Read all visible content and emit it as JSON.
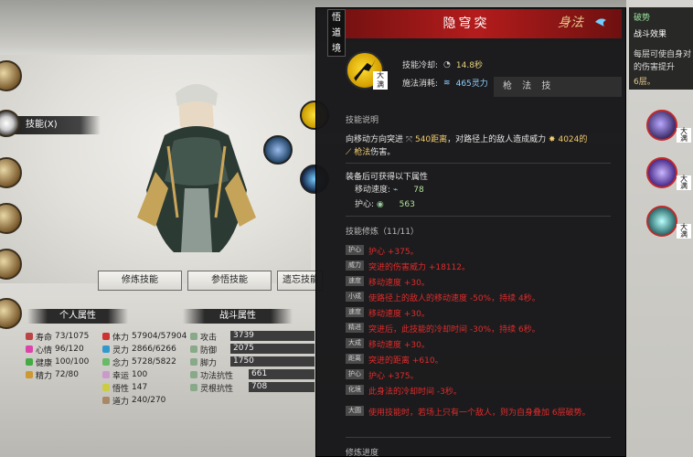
{
  "left_tab": {
    "label": "技能(X)"
  },
  "actions": {
    "cultivate": "修炼技能",
    "comprehend": "参悟技能",
    "forget": "遗忘技能"
  },
  "personal": {
    "header": "个人属性",
    "stats": [
      {
        "label": "寿命",
        "value": "73/1075",
        "color": "#b44"
      },
      {
        "label": "心情",
        "value": "96/120",
        "color": "#d4a"
      },
      {
        "label": "健康",
        "value": "100/100",
        "color": "#4a4"
      },
      {
        "label": "精力",
        "value": "72/80",
        "color": "#c93"
      }
    ],
    "stats2": [
      {
        "label": "体力",
        "value": "57904/57904",
        "color": "#c33"
      },
      {
        "label": "灵力",
        "value": "2866/6266",
        "color": "#39c"
      },
      {
        "label": "念力",
        "value": "5728/5822",
        "color": "#6b6"
      },
      {
        "label": "幸运",
        "value": "100",
        "color": "#c9c"
      },
      {
        "label": "悟性",
        "value": "147",
        "color": "#cc4"
      },
      {
        "label": "道力",
        "value": "240/270",
        "color": "#a86"
      }
    ]
  },
  "combat": {
    "header": "战斗属性",
    "stats": [
      {
        "label": "攻击",
        "value": "3739"
      },
      {
        "label": "防御",
        "value": "2075"
      },
      {
        "label": "脚力",
        "value": "1750"
      },
      {
        "label": "功法抗性",
        "value": "661"
      },
      {
        "label": "灵根抗性",
        "value": "708"
      }
    ]
  },
  "popup": {
    "vertical_tag": "悟\n道\n境",
    "title": "隐穹突",
    "category": "身法",
    "icon_badge": "大\n满",
    "cooldown_label": "技能冷却:",
    "cooldown_value": "14.8秒",
    "cost_label": "施法消耗:",
    "cost_value": "465灵力",
    "desc_title": "技能说明",
    "desc_a": "向移动方向突进",
    "desc_dist": "540距离",
    "desc_b": "，对路径上的敌人造成威力",
    "desc_power": "4024的",
    "desc_c": "枪法",
    "desc_d": "伤害。",
    "equip_title": "装备后可获得以下属性",
    "equip": [
      {
        "label": "移动速度:",
        "value": "78"
      },
      {
        "label": "护心:",
        "value": "563"
      }
    ],
    "cult_title": "技能修炼（11/11）",
    "cultivations": [
      {
        "tag": "护心",
        "text": "护心 +375。"
      },
      {
        "tag": "威力",
        "text": "突进的伤害威力 +18112。"
      },
      {
        "tag": "速度",
        "text": "移动速度 +30。"
      },
      {
        "tag": "小成",
        "text": "使路径上的敌人的移动速度 -50%，持续 4秒。"
      },
      {
        "tag": "速度",
        "text": "移动速度 +30。"
      },
      {
        "tag": "精进",
        "text": "突进后，此技能的冷却时间 -30%，持续 6秒。"
      },
      {
        "tag": "大成",
        "text": "移动速度 +30。"
      },
      {
        "tag": "距离",
        "text": "突进的距离 +610。"
      },
      {
        "tag": "护心",
        "text": "护心 +375。"
      },
      {
        "tag": "化境",
        "text": "此身法的冷却时间 -3秒。"
      },
      {
        "tag": "大圆",
        "text": "使用技能时，若场上只有一个敌人，则为自身叠加 6层破势。"
      }
    ],
    "progress_label": "修炼进度"
  },
  "right": {
    "title": "破势",
    "subtitle": "战斗效果",
    "line1": "每层可使自身对",
    "line2": "的伤害提升",
    "layers": "6层。",
    "slot_badge": "大\n满"
  },
  "hidden_strip": "枪 法 技"
}
